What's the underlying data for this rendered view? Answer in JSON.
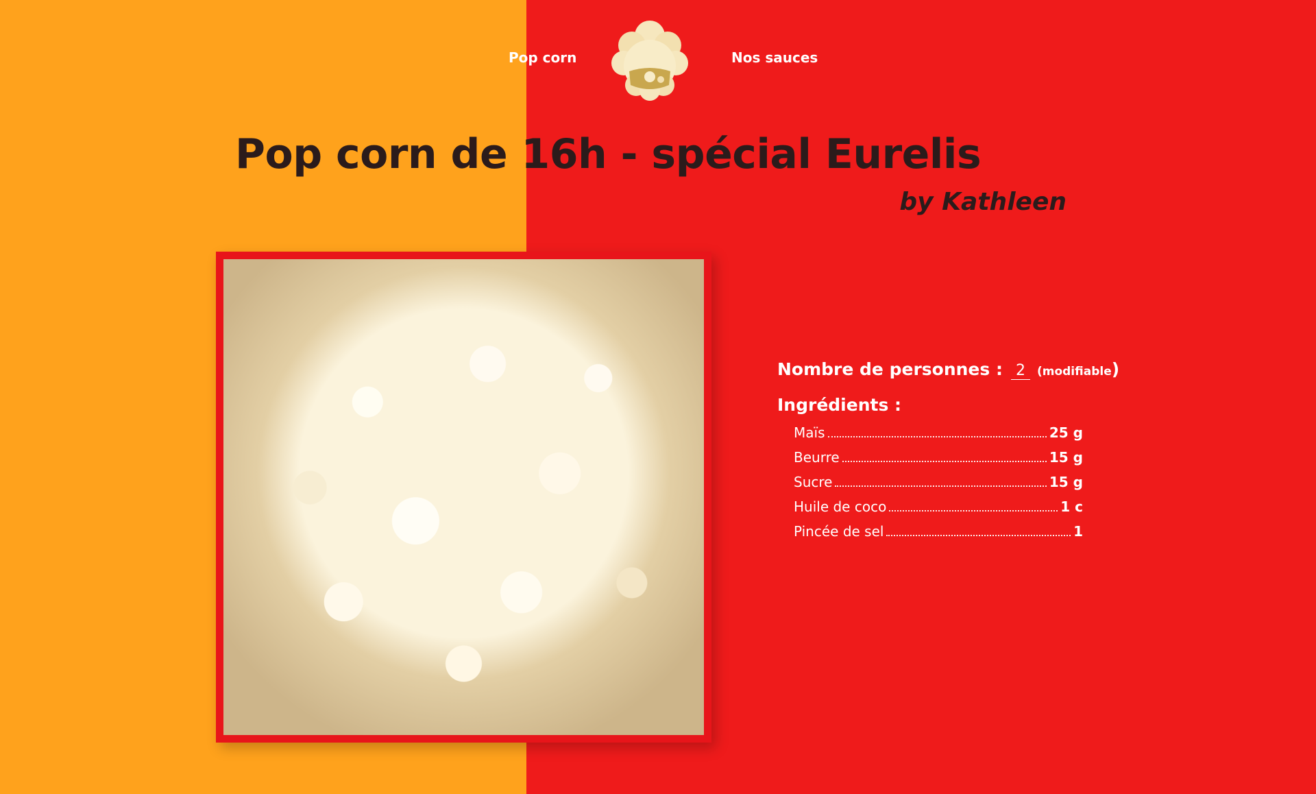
{
  "nav": {
    "left_label": "Pop corn",
    "right_label": "Nos sauces",
    "logo_icon": "popcorn-mascot-logo-icon"
  },
  "recipe": {
    "title": "Pop corn de 16h - spécial Eurelis",
    "author": "by Kathleen",
    "image": "popcorn-photo"
  },
  "servings": {
    "label": "Nombre de personnes :",
    "value": "2",
    "hint": "(modifiable",
    "hint_close": ")"
  },
  "ingredients": {
    "heading": "Ingrédients :",
    "items": [
      {
        "name": "Maïs",
        "qty": "25 g"
      },
      {
        "name": "Beurre",
        "qty": "15 g"
      },
      {
        "name": "Sucre",
        "qty": "15 g"
      },
      {
        "name": "Huile de coco",
        "qty": "1 c"
      },
      {
        "name": "Pincée de sel",
        "qty": "1"
      }
    ]
  },
  "colors": {
    "orange": "#FFA21C",
    "red": "#EF1B1B",
    "text_dark": "#2B1B1B",
    "frame": "#E8151A"
  }
}
